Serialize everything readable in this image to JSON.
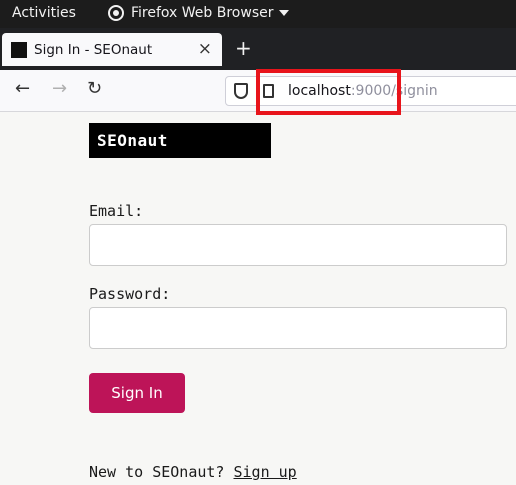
{
  "topbar": {
    "activities": "Activities",
    "app_name": "Firefox Web Browser"
  },
  "tab": {
    "title": "Sign In - SEOnaut",
    "close": "×"
  },
  "newtab": "+",
  "nav": {
    "back": "←",
    "forward": "→",
    "reload": "↻"
  },
  "url": {
    "host": "localhost",
    "rest": ":9000/signin"
  },
  "page": {
    "logo": "SEOnaut",
    "email_label": "Email:",
    "email_value": "",
    "password_label": "Password:",
    "password_value": "",
    "signin_button": "Sign In",
    "signup_prompt": "New to SEOnaut?",
    "signup_link": "Sign up"
  },
  "colors": {
    "accent": "#bd1458",
    "highlight_box": "#e8141b"
  }
}
